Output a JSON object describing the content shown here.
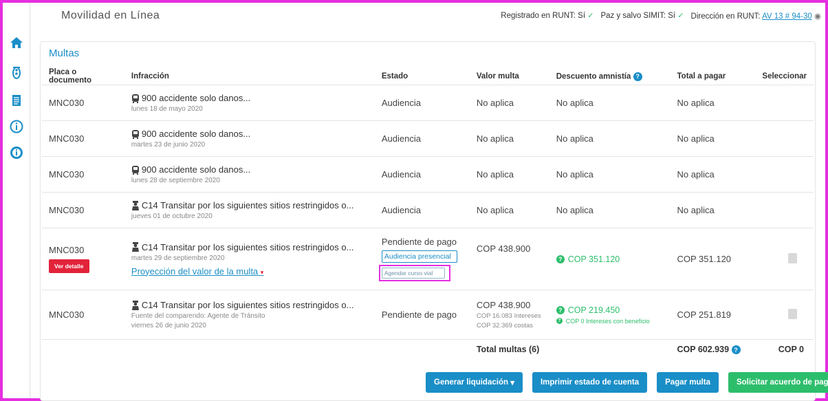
{
  "app": {
    "title": "Movilidad en Línea"
  },
  "status": {
    "runt_label": "Registrado en RUNT: Sí",
    "simit_label": "Paz y salvo SIMIT: Sí",
    "dir_label": "Dirección en RUNT:",
    "dir_value": "AV 13 # 94-30"
  },
  "sidebar": {
    "items": [
      {
        "icon": "home-icon"
      },
      {
        "icon": "traffic-light-icon"
      },
      {
        "icon": "document-icon"
      },
      {
        "icon": "info-icon"
      },
      {
        "icon": "info-filled-icon"
      }
    ]
  },
  "card": {
    "title": "Multas"
  },
  "table": {
    "headers": {
      "placa": "Placa o documento",
      "infraccion": "Infracción",
      "estado": "Estado",
      "valor": "Valor multa",
      "descuento": "Descuento amnistía",
      "total": "Total a pagar",
      "seleccionar": "Seleccionar"
    },
    "rows": [
      {
        "placa": "MNC030",
        "title": "900 accidente solo danos...",
        "date": "lunes 18 de mayo 2020",
        "estado": "Audiencia",
        "valor": "No aplica",
        "descuento": "No aplica",
        "total": "No aplica"
      },
      {
        "placa": "MNC030",
        "title": "900 accidente solo danos...",
        "date": "martes 23 de junio 2020",
        "estado": "Audiencia",
        "valor": "No aplica",
        "descuento": "No aplica",
        "total": "No aplica"
      },
      {
        "placa": "MNC030",
        "title": "900 accidente solo danos...",
        "date": "lunes 28 de septiembre 2020",
        "estado": "Audiencia",
        "valor": "No aplica",
        "descuento": "No aplica",
        "total": "No aplica"
      },
      {
        "placa": "MNC030",
        "title": "C14 Transitar por los siguientes sitios restringidos o...",
        "date": "jueves 01 de octubre 2020",
        "estado": "Audiencia",
        "valor": "No aplica",
        "descuento": "No aplica",
        "total": "No aplica"
      },
      {
        "placa": "MNC030",
        "detalle": "Ver detalle",
        "title": "C14 Transitar por los siguientes sitios restringidos o...",
        "date": "martes 29 de septiembre 2020",
        "proyeccion": "Proyección del valor de la multa",
        "estado": "Pendiente de pago",
        "btn_audiencia": "Audiencia presencial",
        "btn_curso": "Agendar curso vial",
        "valor": "COP 438.900",
        "descuento": "COP 351.120",
        "total": "COP 351.120"
      },
      {
        "placa": "MNC030",
        "title": "C14 Transitar por los siguientes sitios restringidos o...",
        "fuente": "Fuente del comparendo: Agente de Tránsito",
        "date": "viernes 26 de junio 2020",
        "estado": "Pendiente de pago",
        "valor": "COP 438.900",
        "intereses": "COP 16.083 Intereses",
        "costas": "COP 32.369 costas",
        "descuento": "COP 219.450",
        "descuento_sub": "COP 0 Intereses con beneficio",
        "total": "COP 251.819"
      }
    ],
    "totals": {
      "label": "Total multas (6)",
      "total": "COP 602.939",
      "selected": "COP 0"
    }
  },
  "actions": {
    "generar": "Generar liquidación",
    "imprimir": "Imprimir estado de cuenta",
    "pagar": "Pagar multa",
    "acuerdo": "Solicitar acuerdo de pago"
  },
  "colors": {
    "accent": "#1a8ec7",
    "success": "#2dbe6c",
    "danger": "#e2233a",
    "highlight": "#e62ee0"
  }
}
